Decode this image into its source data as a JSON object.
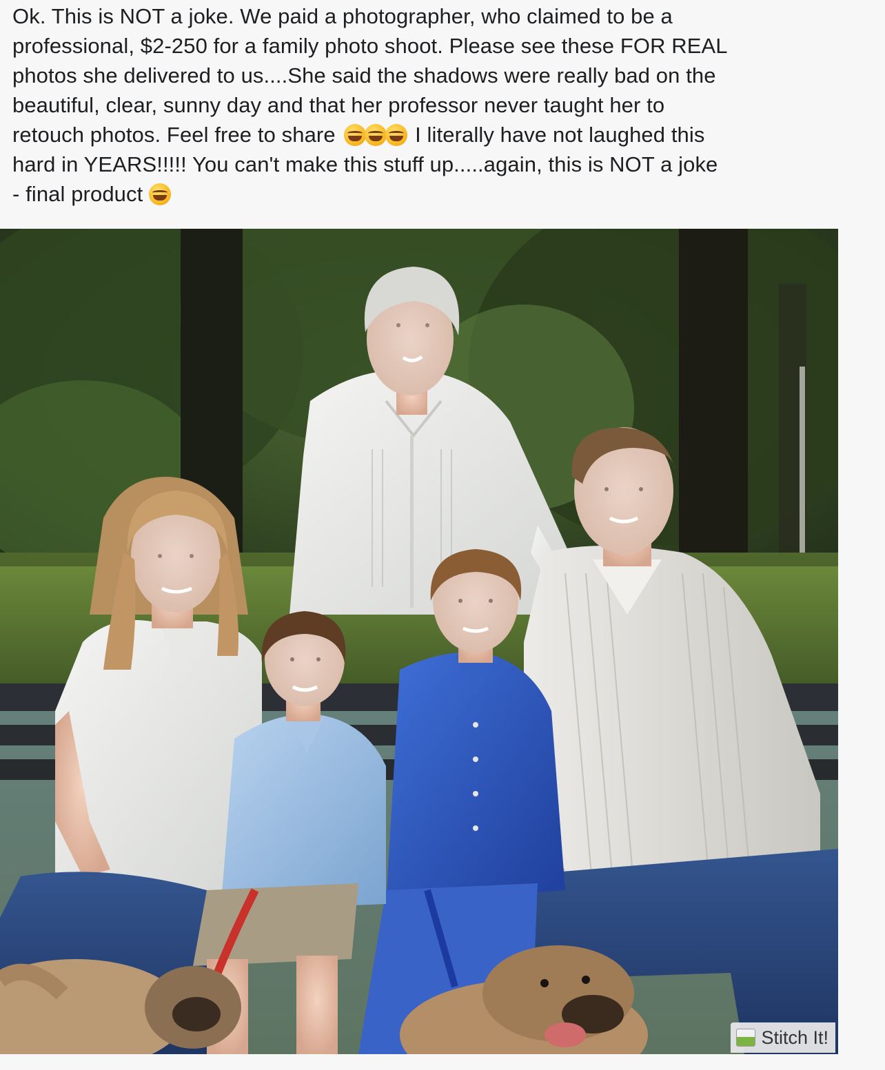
{
  "post": {
    "lines": [
      "Ok.  This is NOT a joke.  We paid a photographer, who claimed to be a",
      "professional, $2-250 for a family photo shoot.  Please see these FOR REAL",
      "photos she delivered to us....She said the shadows were really bad on the",
      "beautiful, clear, sunny day and that her professor never taught her to",
      "hard in YEARS!!!!!  You can't make this stuff up.....again, this is NOT a joke",
      "- final product"
    ],
    "line5_before": "retouch photos.  Feel free to share",
    "line5_after": "I literally have not laughed this",
    "emoji_names": [
      "face-with-tears-of-joy-icon",
      "face-with-tears-of-joy-icon",
      "face-with-tears-of-joy-icon",
      "rolling-on-floor-laughing-icon"
    ]
  },
  "photo": {
    "watermark": "Stitch It!"
  },
  "colors": {
    "text": "#1c1e21",
    "background": "#f7f7f7",
    "emoji": "#f7b21c"
  }
}
